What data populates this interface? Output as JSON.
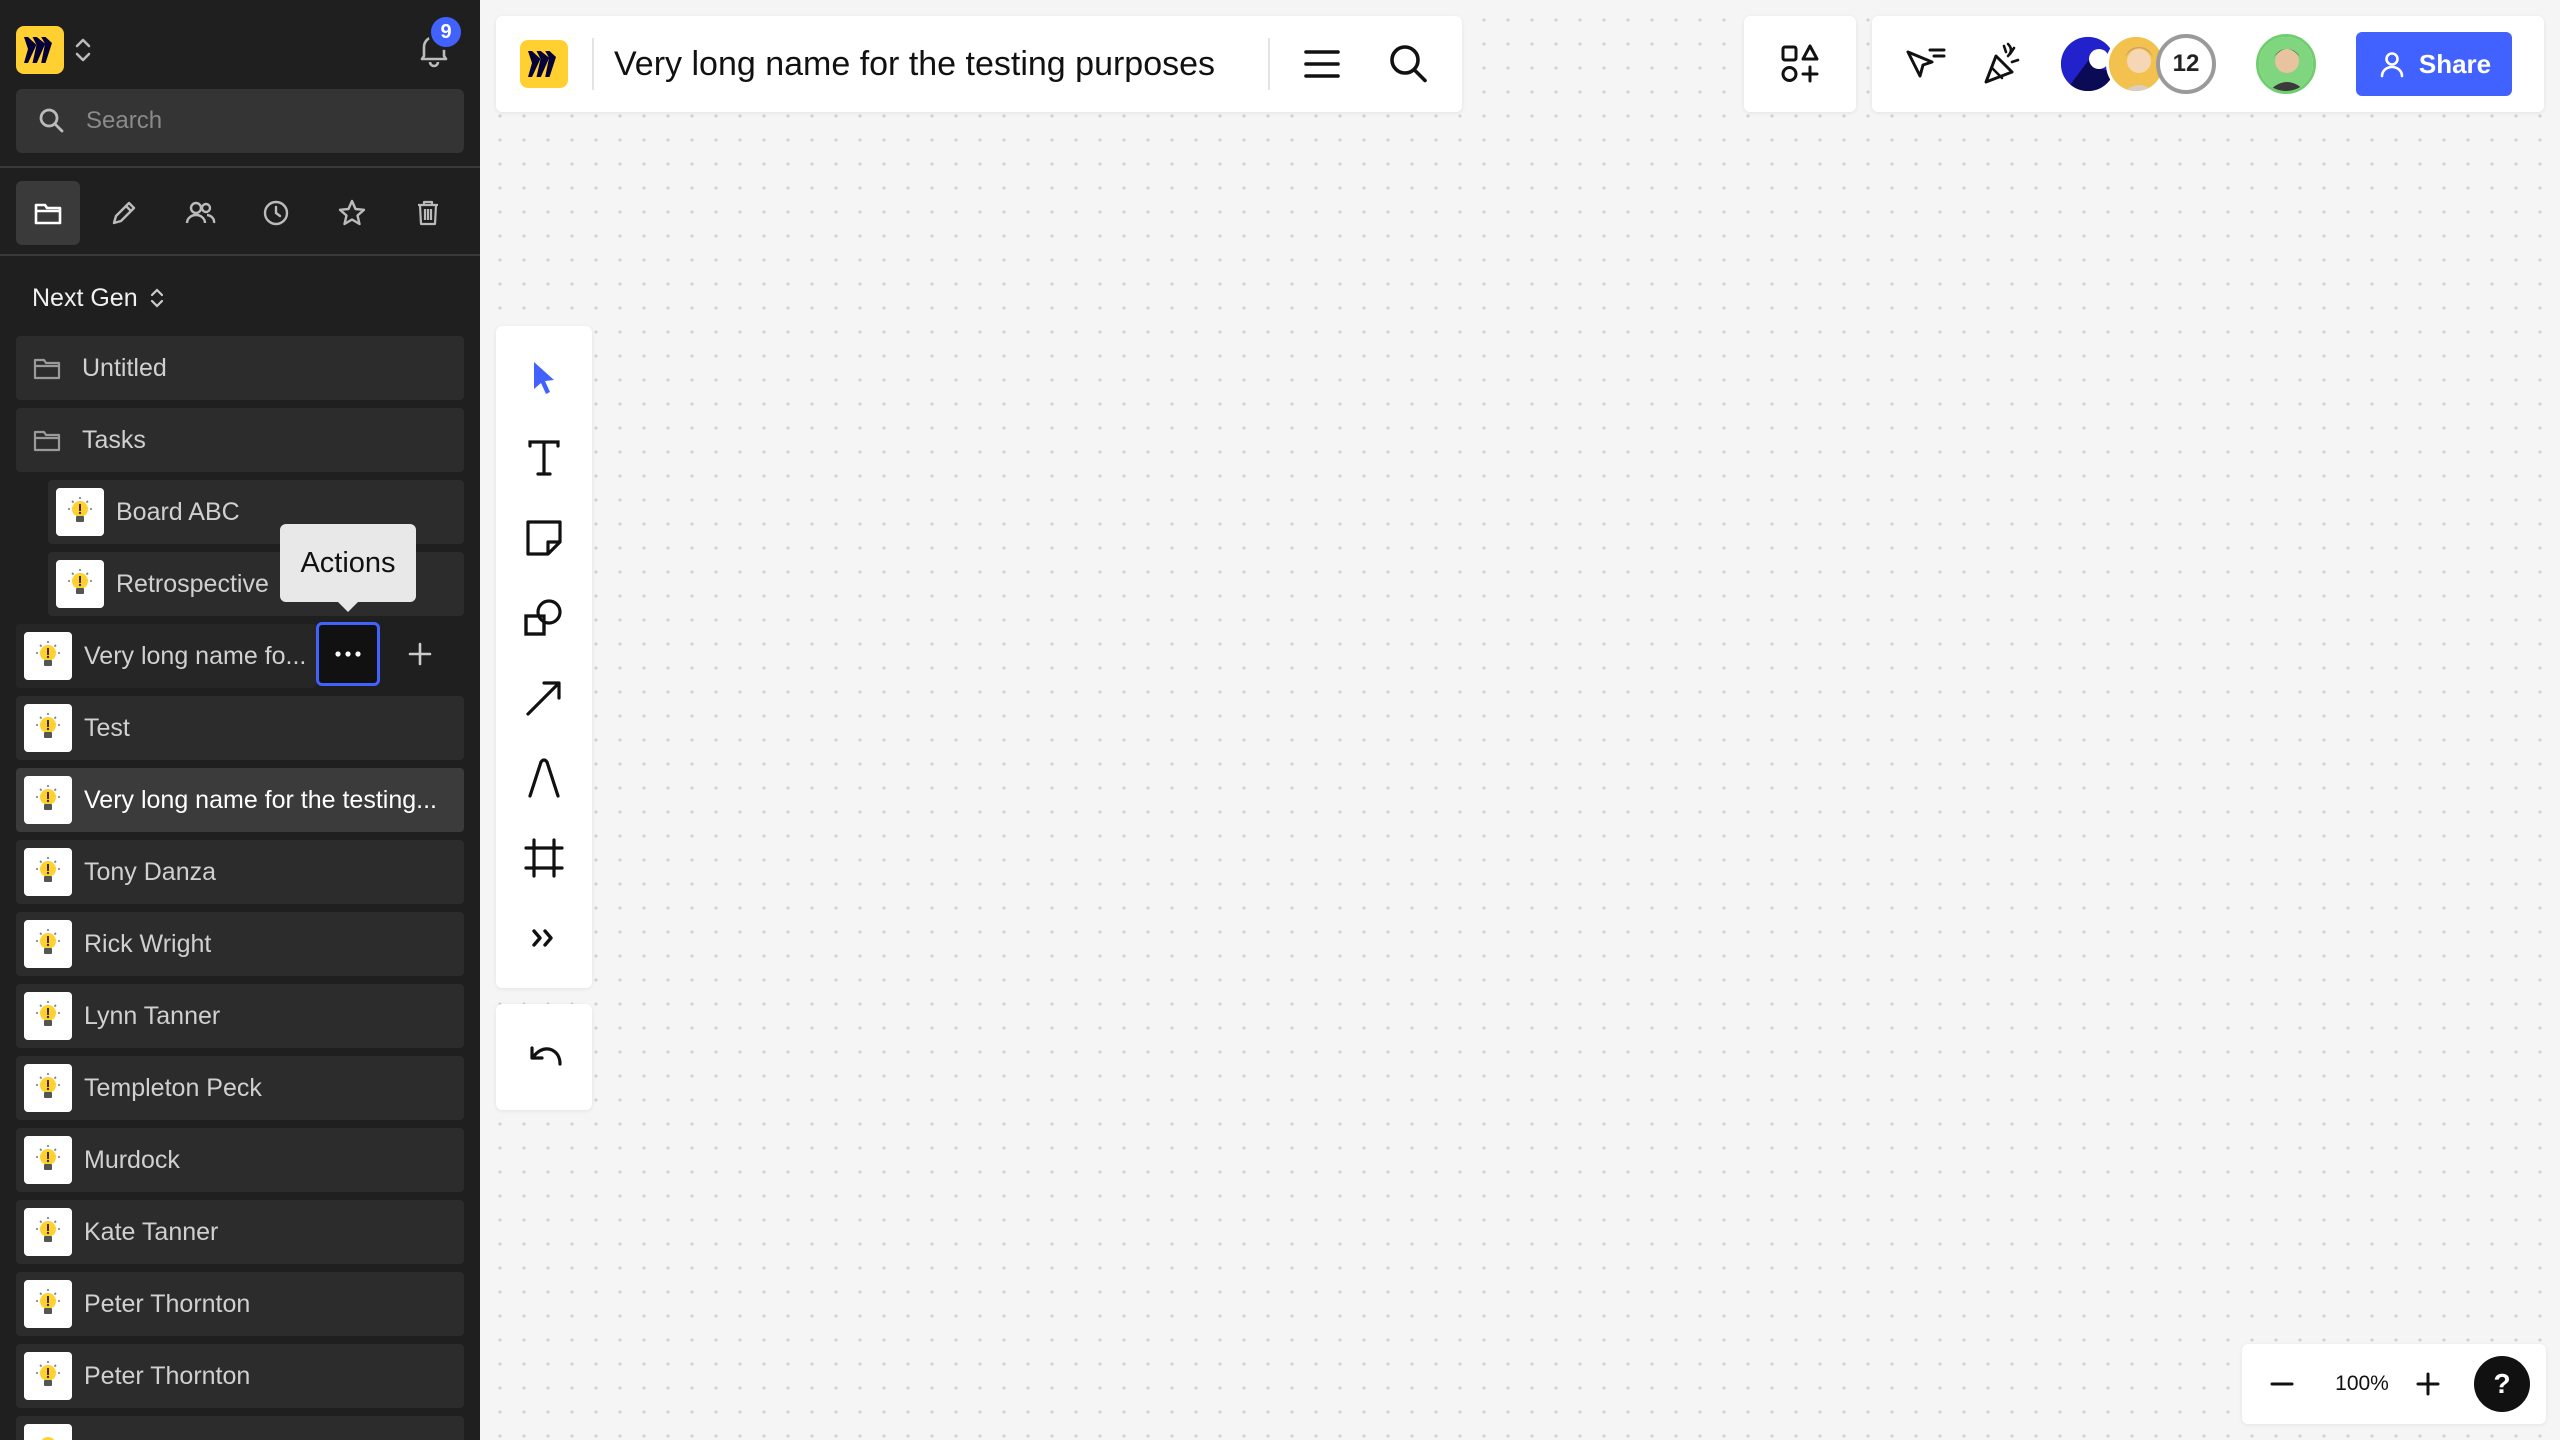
{
  "sidebar": {
    "notification_count": "9",
    "search_placeholder": "Search",
    "team_name": "Next Gen",
    "tabs": [
      "folder-icon",
      "pencil-icon",
      "people-icon",
      "clock-icon",
      "star-icon",
      "trash-icon"
    ],
    "items": [
      {
        "label": "Untitled",
        "type": "folder"
      },
      {
        "label": "Tasks",
        "type": "folder"
      },
      {
        "label": "Board ABC",
        "type": "board"
      },
      {
        "label": "Retrospective",
        "type": "board"
      },
      {
        "label": "Very long name fo...",
        "type": "board"
      },
      {
        "label": "Test",
        "type": "board"
      },
      {
        "label": "Very long name for the testing...",
        "type": "board"
      },
      {
        "label": "Tony Danza",
        "type": "board"
      },
      {
        "label": "Rick Wright",
        "type": "board"
      },
      {
        "label": "Lynn Tanner",
        "type": "board"
      },
      {
        "label": "Templeton Peck",
        "type": "board"
      },
      {
        "label": "Murdock",
        "type": "board"
      },
      {
        "label": "Kate Tanner",
        "type": "board"
      },
      {
        "label": "Peter Thornton",
        "type": "board"
      },
      {
        "label": "Peter Thornton",
        "type": "board"
      }
    ],
    "tooltip": "Actions"
  },
  "topbar": {
    "board_title": "Very long name for the testing purposes",
    "collaborator_count": "12",
    "share_label": "Share"
  },
  "zoom": {
    "level": "100%",
    "help_label": "?"
  },
  "colors": {
    "accent": "#4262ff",
    "brand": "#ffd02f",
    "sidebar_bg": "#1f1f1f"
  }
}
